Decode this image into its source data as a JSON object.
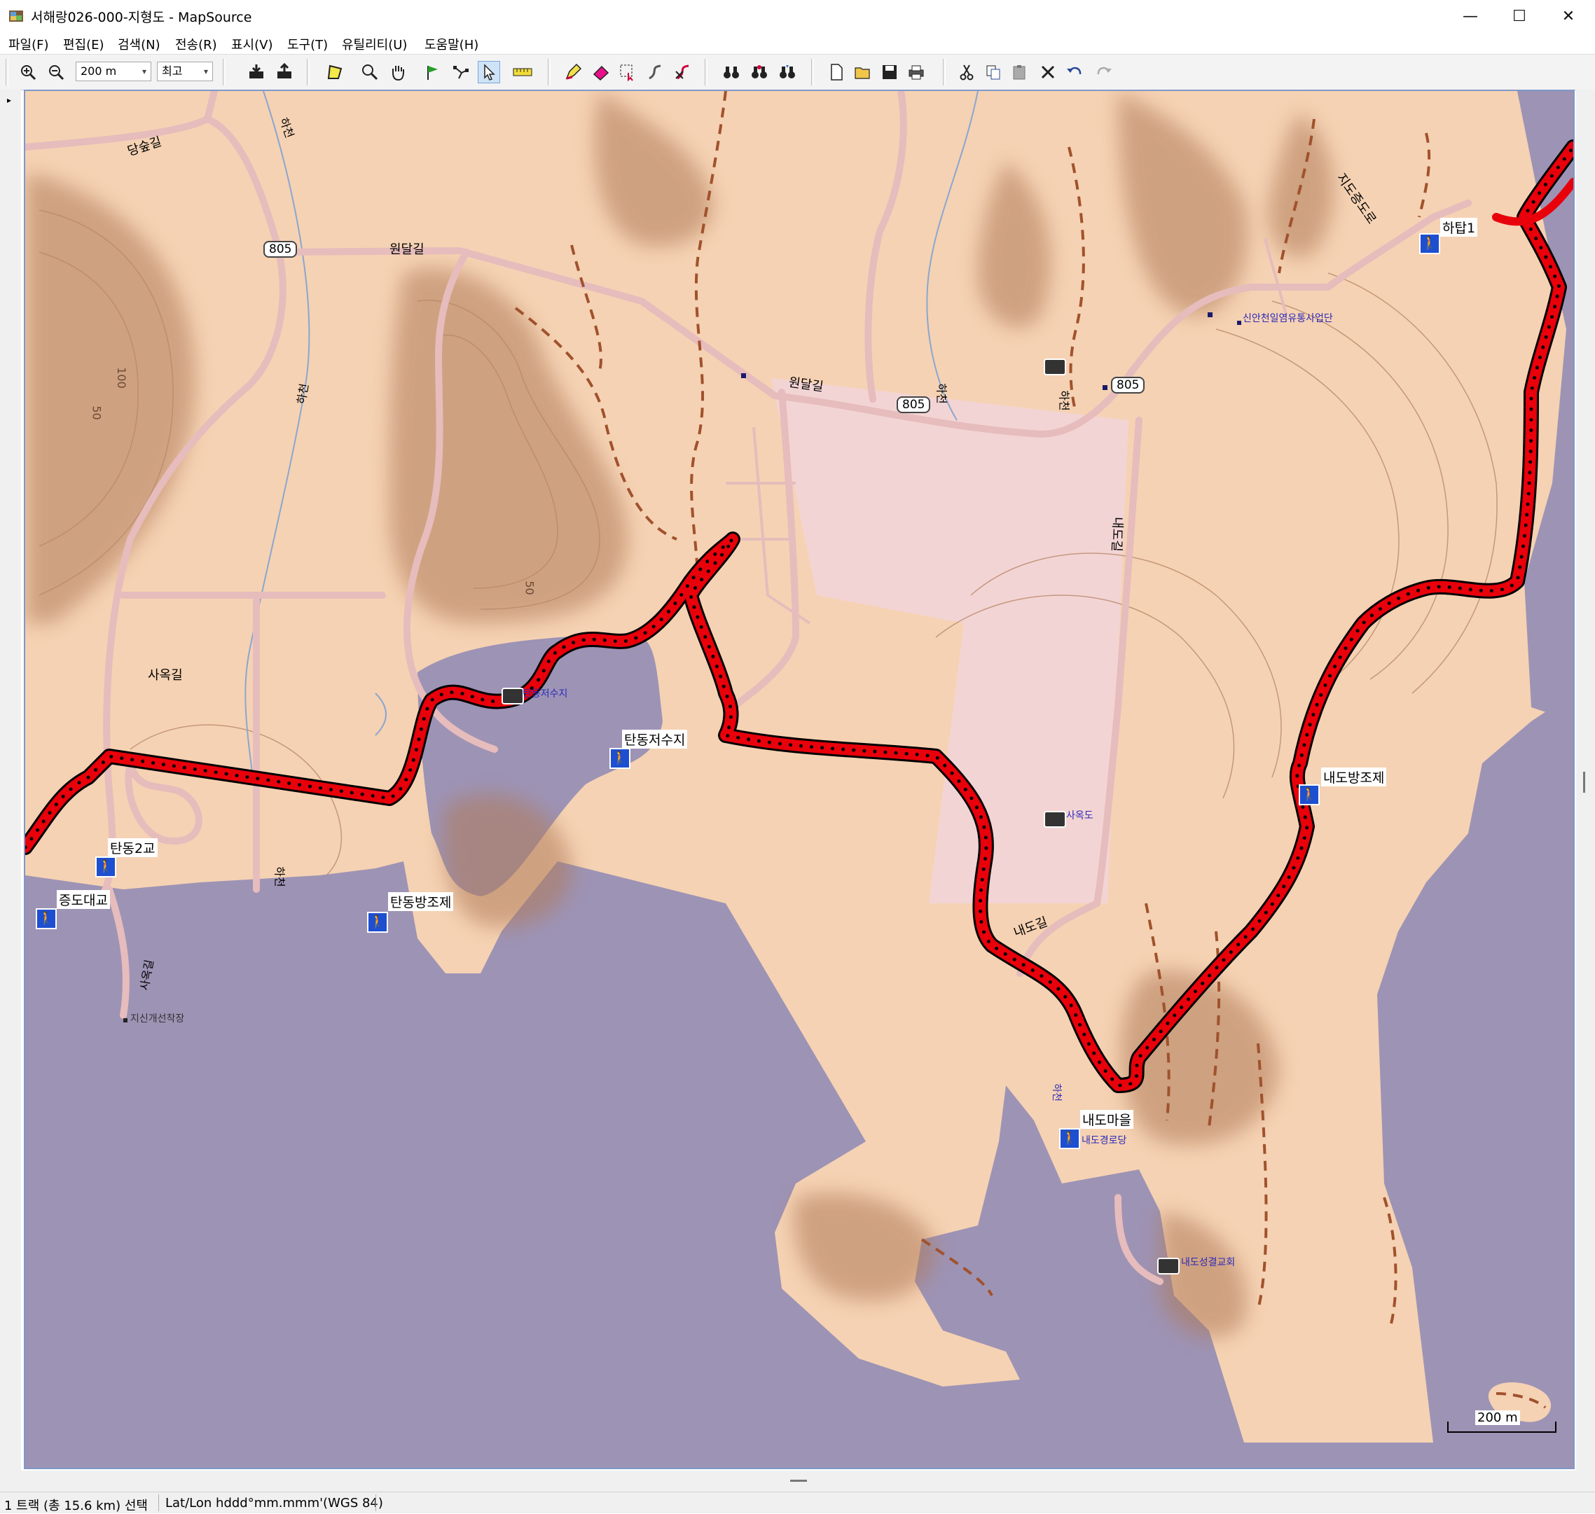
{
  "window": {
    "title": "서해랑026-000-지형도 - MapSource",
    "controls": {
      "minimize": "—",
      "maximize": "☐",
      "close": "✕"
    }
  },
  "menu": [
    "파일(F)",
    "편집(E)",
    "검색(N)",
    "전송(R)",
    "표시(V)",
    "도구(T)",
    "유틸리티(U)",
    "도움말(H)"
  ],
  "toolbar": {
    "zoom_scale": "200 m",
    "detail_level": "최고"
  },
  "map": {
    "road_labels": [
      {
        "text": "당숲길"
      },
      {
        "text": "원달길"
      },
      {
        "text": "원달길"
      },
      {
        "text": "사옥길"
      },
      {
        "text": "내도길"
      },
      {
        "text": "내도길"
      },
      {
        "text": "지도증도로"
      },
      {
        "text": "하천"
      },
      {
        "text": "하천"
      },
      {
        "text": "하천"
      },
      {
        "text": "하천"
      },
      {
        "text": "하천"
      },
      {
        "text": "사옥길"
      }
    ],
    "route_shields": [
      {
        "text": "805"
      },
      {
        "text": "805"
      },
      {
        "text": "805"
      }
    ],
    "contour_labels": [
      {
        "text": "100"
      },
      {
        "text": "50"
      },
      {
        "text": "50"
      }
    ],
    "waypoints": [
      {
        "label": "하탑1"
      },
      {
        "label": "탄동저수지"
      },
      {
        "label": "내도방조제"
      },
      {
        "label": "탄동2교"
      },
      {
        "label": "증도대교"
      },
      {
        "label": "탄동방조제"
      },
      {
        "label": "내도마을"
      }
    ],
    "poi_labels": [
      {
        "text": "신안천일염유통사업단"
      },
      {
        "text": "탄동저수지"
      },
      {
        "text": "사옥도"
      },
      {
        "text": "내도성결교회"
      },
      {
        "text": "지신개선착장"
      },
      {
        "text": "내도경로당"
      },
      {
        "text": "하천"
      }
    ],
    "scale_bar": "200 m",
    "colors": {
      "land": "#f5d2b3",
      "water": "#9d93b5",
      "track": "#e8000b",
      "road": "#f2cbcb",
      "trail": "#a0522d",
      "stream": "#8ba6d0",
      "salt_farm": "#f3d4d4"
    }
  },
  "status": {
    "selection": "1 트랙 (총 15.6 km) 선택",
    "coords": "Lat/Lon hddd°mm.mmm'(WGS 84)"
  }
}
